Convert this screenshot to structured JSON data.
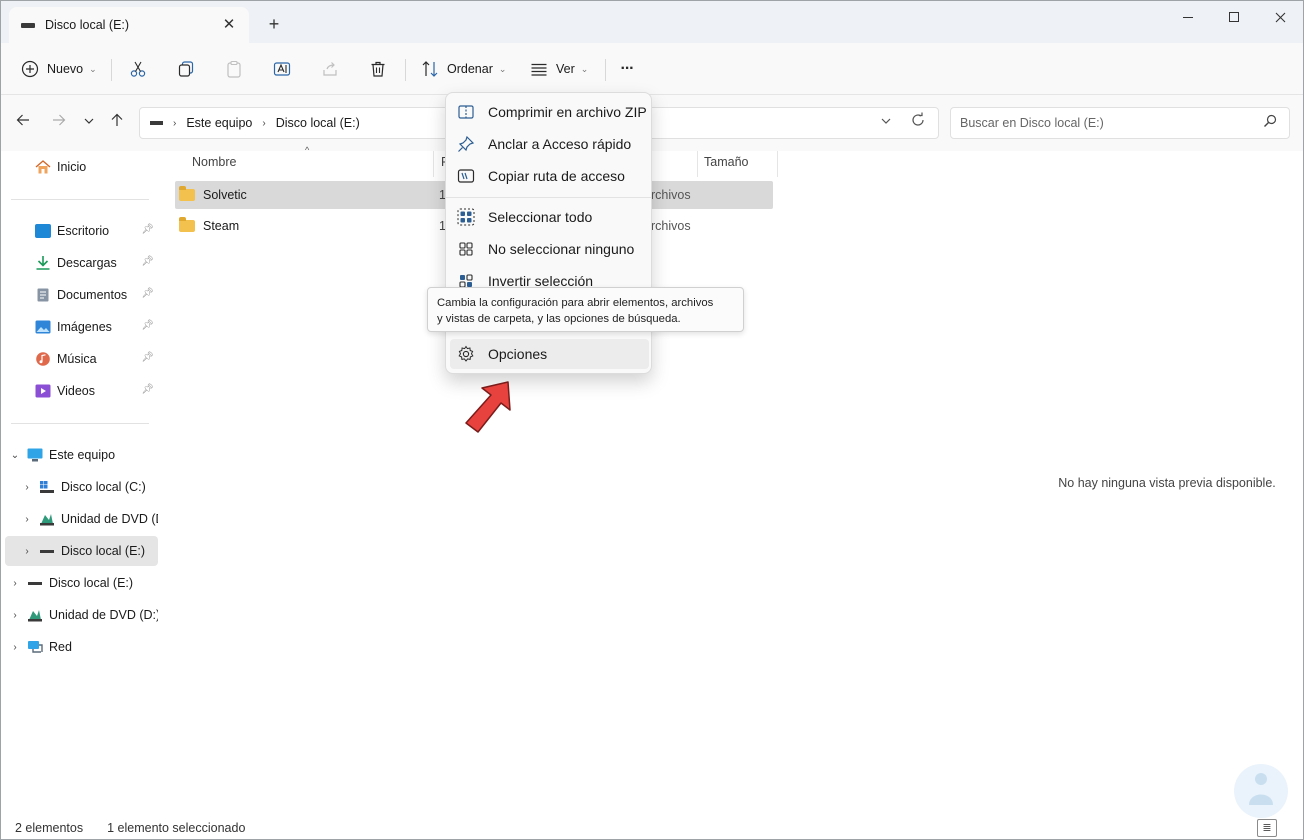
{
  "window": {
    "tab_title": "Disco local (E:)",
    "close_tab_glyph": "✕",
    "new_tab_glyph": "+"
  },
  "toolbar": {
    "new_label": "Nuevo",
    "sort_label": "Ordenar",
    "view_label": "Ver",
    "more_glyph": "···",
    "icons": [
      "add-icon",
      "cut-icon",
      "copy-icon",
      "paste-icon",
      "rename-icon",
      "share-icon",
      "delete-icon",
      "sort-icon",
      "view-icon",
      "more-icon"
    ]
  },
  "address": {
    "crumbs": [
      "Este equipo",
      "Disco local (E:)"
    ],
    "search_placeholder": "Buscar en Disco local (E:)"
  },
  "sidebar": {
    "home": "Inicio",
    "quick_access": [
      {
        "label": "Escritorio",
        "icon": "desktop-icon",
        "color": "#1e88d6"
      },
      {
        "label": "Descargas",
        "icon": "downloads-icon",
        "color": "#1a9a58"
      },
      {
        "label": "Documentos",
        "icon": "documents-icon",
        "color": "#7b8796"
      },
      {
        "label": "Imágenes",
        "icon": "pictures-icon",
        "color": "#2f86d9"
      },
      {
        "label": "Música",
        "icon": "music-icon",
        "color": "#e0684b"
      },
      {
        "label": "Videos",
        "icon": "videos-icon",
        "color": "#8b4fd6"
      }
    ],
    "this_pc": "Este equipo",
    "this_pc_children": [
      {
        "label": "Disco local (C:)",
        "icon": "windows-drive-icon"
      },
      {
        "label": "Unidad de DVD (D:)",
        "icon": "dvd-icon"
      },
      {
        "label": "Disco local (E:)",
        "icon": "drive-icon"
      }
    ],
    "root_items": [
      {
        "label": "Disco local (E:)",
        "icon": "drive-icon"
      },
      {
        "label": "Unidad de DVD (D:)",
        "icon": "dvd-icon"
      },
      {
        "label": "Red",
        "icon": "network-icon"
      }
    ]
  },
  "content": {
    "columns": {
      "name": "Nombre",
      "date": "F",
      "size": "Tamaño"
    },
    "rows": [
      {
        "name": "Solvetic",
        "date": "1",
        "type": "rchivos"
      },
      {
        "name": "Steam",
        "date": "1",
        "type": "rchivos"
      }
    ],
    "preview_text": "No hay ninguna vista previa disponible."
  },
  "menu": {
    "items": [
      {
        "label": "Comprimir en archivo ZIP",
        "icon": "zip-icon"
      },
      {
        "label": "Anclar a Acceso rápido",
        "icon": "pin-icon"
      },
      {
        "label": "Copiar ruta de acceso",
        "icon": "copy-path-icon"
      },
      {
        "label": "Seleccionar todo",
        "icon": "select-all-icon"
      },
      {
        "label": "No seleccionar ninguno",
        "icon": "select-none-icon"
      },
      {
        "label": "Invertir selección",
        "icon": "invert-selection-icon"
      },
      {
        "label": "Opciones",
        "icon": "gear-icon"
      }
    ]
  },
  "tooltip": {
    "line1": "Cambia la configuración para abrir elementos, archivos",
    "line2": "y vistas de carpeta, y las opciones de búsqueda."
  },
  "status": {
    "count": "2 elementos",
    "selected": "1 elemento seleccionado"
  },
  "colors": {
    "accent": "#0067c0",
    "arrow": "#e8423f",
    "folder": "#f2c14e"
  }
}
